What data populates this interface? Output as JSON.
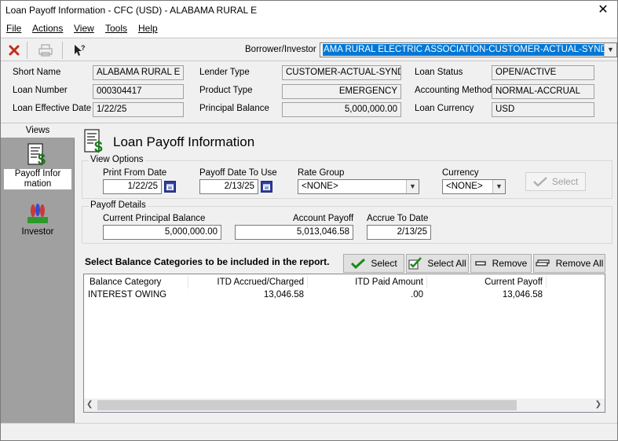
{
  "window": {
    "title": "Loan Payoff Information - CFC (USD) - ALABAMA RURAL E",
    "close_glyph": "✕"
  },
  "menu": {
    "file": "File",
    "actions": "Actions",
    "view": "View",
    "tools": "Tools",
    "help": "Help"
  },
  "toolbar": {
    "borrower_label": "Borrower/Investor",
    "borrower_value": "AMA RURAL ELECTRIC ASSOCIATION-CUSTOMER-ACTUAL-SYND"
  },
  "info": {
    "short_name_label": "Short Name",
    "short_name": "ALABAMA RURAL E",
    "loan_number_label": "Loan Number",
    "loan_number": "000304417",
    "effective_date_label": "Loan Effective Date",
    "effective_date": "1/22/25",
    "lender_type_label": "Lender Type",
    "lender_type": "CUSTOMER-ACTUAL-SYND",
    "product_type_label": "Product Type",
    "product_type": "EMERGENCY",
    "principal_balance_label": "Principal Balance",
    "principal_balance": "5,000,000.00",
    "loan_status_label": "Loan Status",
    "loan_status": "OPEN/ACTIVE",
    "accounting_method_label": "Accounting Method",
    "accounting_method": "NORMAL-ACCRUAL",
    "loan_currency_label": "Loan Currency",
    "loan_currency": "USD"
  },
  "sidebar": {
    "header": "Views",
    "items": [
      {
        "label_line1": "Payoff Infor",
        "label_line2": "mation"
      },
      {
        "label_line1": "Investor",
        "label_line2": ""
      }
    ]
  },
  "page": {
    "title": "Loan Payoff Information"
  },
  "view_options": {
    "title": "View Options",
    "print_from_label": "Print From Date",
    "print_from": "1/22/25",
    "payoff_to_label": "Payoff Date To Use",
    "payoff_to": "2/13/25",
    "rate_group_label": "Rate Group",
    "rate_group": "<NONE>",
    "currency_label": "Currency",
    "currency": "<NONE>",
    "select_label": "Select"
  },
  "payoff_details": {
    "title": "Payoff Details",
    "current_principal_label": "Current Principal Balance",
    "current_principal": "5,000,000.00",
    "account_payoff_label": "Account Payoff",
    "account_payoff": "5,013,046.58",
    "accrue_to_label": "Accrue To Date",
    "accrue_to": "2/13/25"
  },
  "balance": {
    "instruction": "Select Balance Categories to be included in the report.",
    "select_btn": "Select",
    "select_all_btn": "Select All",
    "remove_btn": "Remove",
    "remove_all_btn": "Remove All",
    "columns": [
      "Balance Category",
      "ITD Accrued/Charged",
      "ITD Paid Amount",
      "Current Payoff"
    ],
    "rows": [
      [
        "INTEREST OWING",
        "13,046.58",
        ".00",
        "13,046.58"
      ]
    ]
  },
  "colors": {
    "selection_blue": "#0078d7",
    "sidebar_gray": "#a0a0a0",
    "close_red": "#c42b1c"
  }
}
